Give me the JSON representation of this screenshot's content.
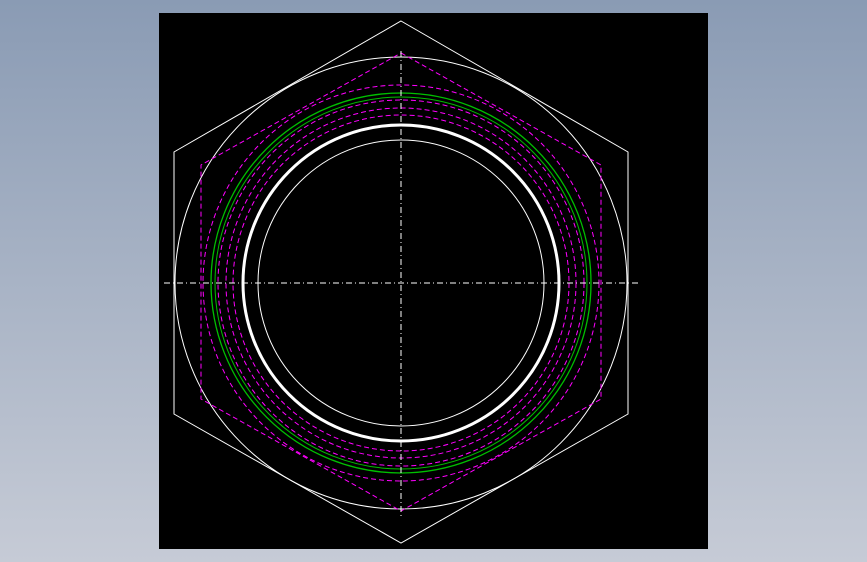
{
  "window": {
    "background_top": "#8A9BB4",
    "background_bottom": "#C6CBD6"
  },
  "drawing": {
    "background_color": "#000000",
    "colors": {
      "geometry": "#FFFFFF",
      "hidden_lines": "#FF00FF",
      "thread": "#00C000",
      "centerlines": "#FFFFFF"
    },
    "entities": [
      "outer-hexagon",
      "hexagon-inscribed-circle",
      "hidden-inner-hexagon",
      "hidden-thread-circles",
      "thread-circles",
      "bore-circles",
      "horizontal-centerline",
      "vertical-centerline"
    ]
  }
}
